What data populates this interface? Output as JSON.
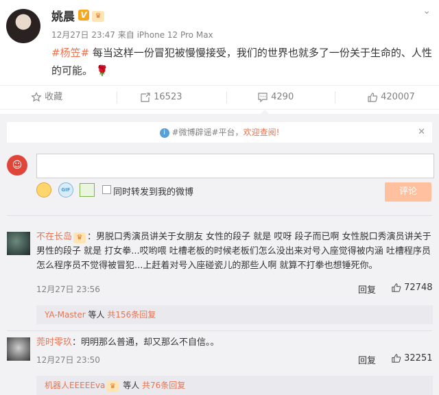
{
  "post": {
    "author": "姚晨",
    "time": "12月27日 23:47",
    "source": "来自 iPhone 12 Pro Max",
    "hashtag": "#杨笠#",
    "text": "每当这样一份冒犯被慢慢接受，我们的世界也就多了一份关于生命的、人性的可能。",
    "badges": [
      "v-badge",
      "crown-badge"
    ]
  },
  "actions": {
    "favorite": "收藏",
    "forward": "16523",
    "comment": "4290",
    "like": "420007"
  },
  "notice": {
    "hashtag": "#微博辟谣#平台，",
    "link": "欢迎查阅!"
  },
  "composer": {
    "placeholder": "",
    "forward_label": "同时转发到我的微博",
    "submit": "评论"
  },
  "comments": [
    {
      "user": "不在长岛",
      "text": "：男脱口秀演员讲关于女朋友 女性的段子 就是 哎呀 段子而已啊 女性脱口秀演员讲关于男性的段子 就是 打女拳...哎哟喂 吐槽老板的时候老板们怎么没出来对号入座觉得被内涵 吐槽程序员怎么程序员不觉得被冒犯...上赶着对号入座碰瓷儿的那些人啊 就算不打拳也想锤死你。",
      "time": "12月27日 23:56",
      "reply": "回复",
      "likes": "72748",
      "sub_user": "YA-Master",
      "sub_mid": " 等人 ",
      "sub_more": "共156条回复"
    },
    {
      "user": "莞时零玖",
      "text": "：明明那么普通，却又那么不自信。。",
      "time": "12月27日 23:50",
      "reply": "回复",
      "likes": "32251",
      "sub_user": "机器人EEEEEva",
      "sub_mid": " 等人 ",
      "sub_more": "共76条回复"
    }
  ],
  "colors": {
    "accent": "#eb7350",
    "panel": "#f2f2f5",
    "submit": "#ffc09f"
  }
}
